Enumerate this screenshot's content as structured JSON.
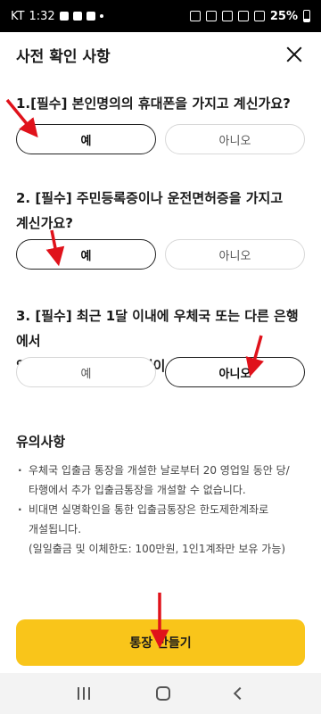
{
  "status_bar": {
    "carrier": "KT",
    "time": "1:32",
    "battery": "25%"
  },
  "header": {
    "title": "사전 확인 사항"
  },
  "questions": [
    {
      "title": "1.[필수] 본인명의의 휴대폰을 가지고 계신가요?",
      "yes_label": "예",
      "no_label": "아니오",
      "selected": "yes"
    },
    {
      "title_line1": "2. [필수] 주민등록증이나 운전면허증을 가지고",
      "title_line2": "계신가요?",
      "yes_label": "예",
      "no_label": "아니오",
      "selected": "yes"
    },
    {
      "title_line1": "3. [필수] 최근 1달 이내에 우체국 또는 다른 은행에서",
      "title_line2": "입출금을 통장을 만든 적이 있으신가요?",
      "yes_label": "예",
      "no_label": "아니오",
      "selected": "no"
    }
  ],
  "notice": {
    "title": "유의사항",
    "items": [
      "우체국 입출금 통장을 개설한 날로부터 20 영업일 동안 당/",
      "타행에서 추가 입출금통장을 개설할 수 없습니다.",
      "비대면 실명확인을 통한 입출금통장은 한도제한계좌로",
      "개설됩니다.",
      "(일일출금 및 이체한도: 100만원, 1인1계좌만 보유 가능)"
    ]
  },
  "primary_button": {
    "label": "통장 만들기",
    "color": "#f9c51a"
  },
  "annotation_color": "#e0121b"
}
